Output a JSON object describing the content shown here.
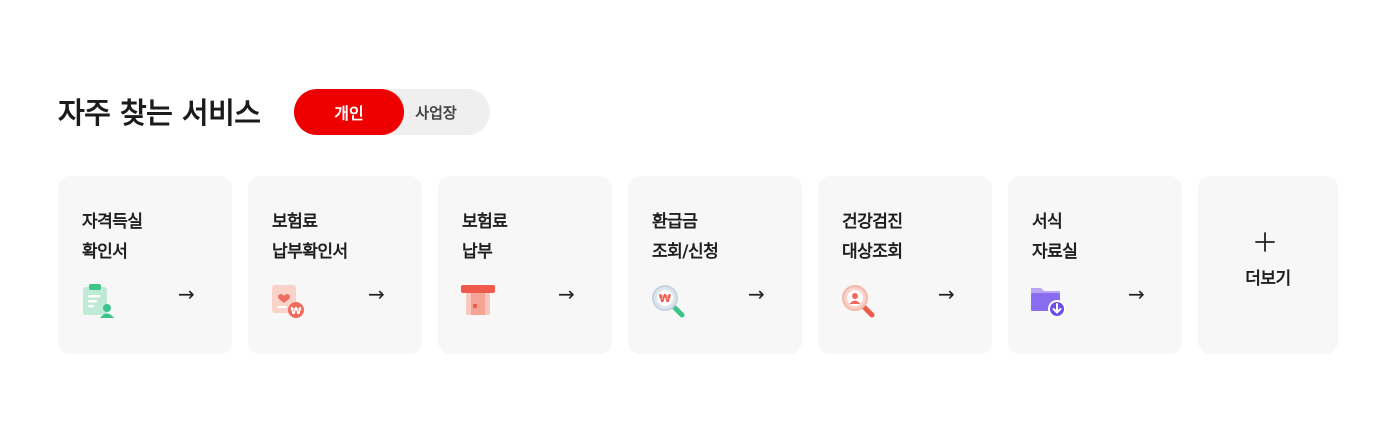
{
  "section": {
    "title": "자주 찾는 서비스",
    "toggle": {
      "active_label": "개인",
      "inactive_label": "사업장"
    }
  },
  "services": [
    {
      "line1": "자격득실",
      "line2": "확인서",
      "icon": "clipboard-user-icon"
    },
    {
      "line1": "보험료",
      "line2": "납부확인서",
      "icon": "receipt-won-icon"
    },
    {
      "line1": "보험료",
      "line2": "납부",
      "icon": "card-payment-icon"
    },
    {
      "line1": "환급금",
      "line2": "조회/신청",
      "icon": "search-won-icon"
    },
    {
      "line1": "건강검진",
      "line2": "대상조회",
      "icon": "search-person-icon"
    },
    {
      "line1": "서식",
      "line2": "자료실",
      "icon": "folder-download-icon"
    }
  ],
  "arrow_glyph": "→",
  "more": {
    "label": "더보기"
  },
  "colors": {
    "accent": "#ee0000",
    "card_bg": "#f7f7f7",
    "toggle_bg": "#efefef",
    "green": "#3cc48a",
    "coral": "#ef6b5b",
    "purple": "#8a6cf0"
  }
}
